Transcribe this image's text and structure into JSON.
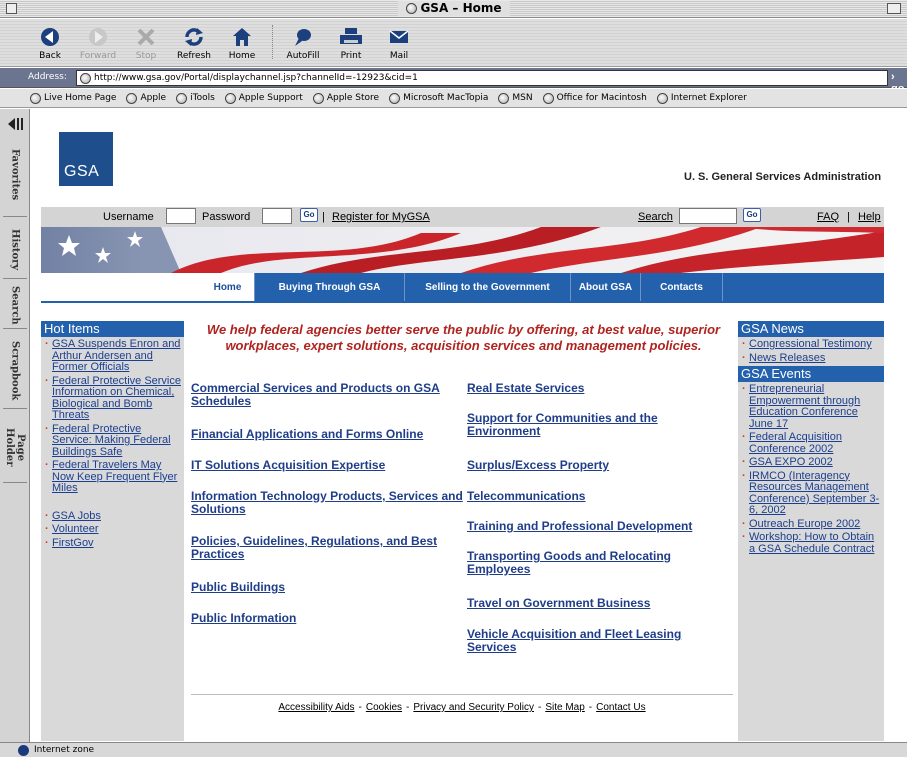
{
  "window": {
    "title": "GSA – Home"
  },
  "toolbar": {
    "back": "Back",
    "forward": "Forward",
    "stop": "Stop",
    "refresh": "Refresh",
    "home": "Home",
    "autofill": "AutoFill",
    "print": "Print",
    "mail": "Mail"
  },
  "address": {
    "label": "Address:",
    "url": "http://www.gsa.gov/Portal/displaychannel.jsp?channelId=-12923&cid=1",
    "go": "go"
  },
  "favorites": [
    "Live Home Page",
    "Apple",
    "iTools",
    "Apple Support",
    "Apple Store",
    "Microsoft MacTopia",
    "MSN",
    "Office for Macintosh",
    "Internet Explorer"
  ],
  "sidetabs": [
    "Favorites",
    "History",
    "Search",
    "Scrapbook",
    "Page Holder"
  ],
  "status": {
    "zone": "Internet zone"
  },
  "page": {
    "logo": "GSA",
    "agency": "U. S. General Services Administration",
    "login": {
      "username_label": "Username",
      "password_label": "Password",
      "go": "Go",
      "register": "Register for MyGSA",
      "search_label": "Search",
      "faq": "FAQ",
      "separator": "|",
      "help": "Help"
    },
    "nav": [
      "Home",
      "Buying Through GSA",
      "Selling to the Government",
      "About GSA",
      "Contacts"
    ],
    "tagline": "We help federal agencies better serve the public by offering, at best value, superior workplaces, expert solutions, acquisition services and management policies.",
    "hot_items": {
      "title": "Hot Items",
      "items": [
        "GSA Suspends Enron and Arthur Andersen and Former Officials",
        "Federal Protective Service Information on Chemical, Biological and Bomb Threats",
        "Federal Protective Service: Making Federal Buildings Safe",
        "Federal Travelers May Now Keep Frequent Flyer Miles"
      ],
      "extra": [
        "GSA Jobs",
        "Volunteer",
        "FirstGov"
      ]
    },
    "links_left": [
      "Commercial Services and Products on GSA Schedules",
      "Financial Applications and Forms Online",
      "IT Solutions Acquisition Expertise",
      "Information Technology Products, Services and Solutions",
      "Policies, Guidelines, Regulations, and Best Practices",
      "Public Buildings",
      "Public Information"
    ],
    "links_right": [
      "Real Estate Services",
      "Support for Communities and the Environment",
      "Surplus/Excess Property",
      "Telecommunications",
      "Training and Professional Development",
      "Transporting Goods and Relocating Employees",
      "Travel on Government Business",
      "Vehicle Acquisition and Fleet Leasing Services"
    ],
    "news": {
      "title": "GSA News",
      "items": [
        "Congressional Testimony",
        "News Releases"
      ]
    },
    "events": {
      "title": "GSA Events",
      "items": [
        "Entrepreneurial Empowerment through Education Conference June 17",
        "Federal Acquisition Conference 2002",
        "GSA EXPO 2002",
        "IRMCO (Interagency Resources Management Conference) September 3-6, 2002",
        "Outreach Europe 2002",
        "Workshop: How to Obtain a GSA Schedule Contract"
      ]
    },
    "footer": [
      "Accessibility Aids",
      "Cookies",
      "Privacy and Security Policy",
      "Site Map",
      "Contact Us"
    ],
    "footer_sep": "-"
  }
}
